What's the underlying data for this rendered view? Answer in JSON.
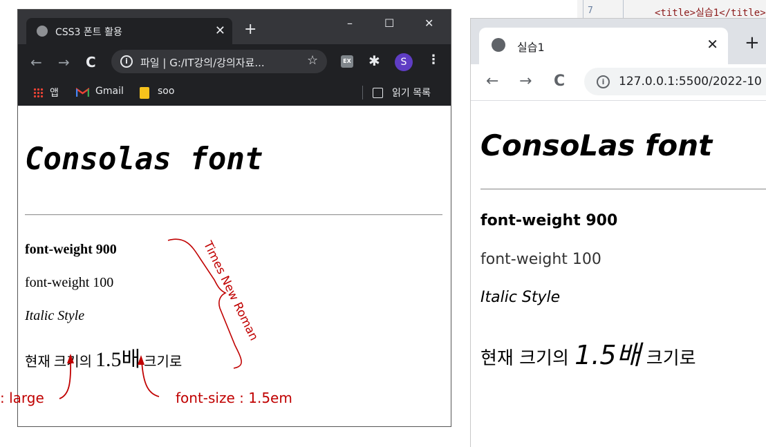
{
  "editor": {
    "line_number": "7",
    "code_line": "<title>실습1</title>"
  },
  "left_browser": {
    "tab_title": "CSS3 폰트 활용",
    "tab_close": "✕",
    "new_tab": "+",
    "window_controls": {
      "minimize": "–",
      "maximize": "☐",
      "close": "✕"
    },
    "nav": {
      "back": "←",
      "forward": "→",
      "reload": "C"
    },
    "address": {
      "info": "i",
      "text": "파일 | G:/IT강의/강의자료...",
      "star": "☆"
    },
    "extensions": {
      "ex_label": "EX",
      "puzzle": "✱",
      "profile_initial": "S",
      "menu": "⋮"
    },
    "bookmarks": [
      {
        "icon": "apps-grid-icon",
        "label": "앱"
      },
      {
        "icon": "gmail-icon",
        "label": "Gmail"
      },
      {
        "icon": "folder-icon",
        "label": "soo"
      }
    ],
    "reading_list": "읽기 목록",
    "page": {
      "heading": "Consolas font",
      "p1": "font-weight 900",
      "p2": "font-weight 100",
      "p3": "Italic Style",
      "p4_a": "현재 크기의 ",
      "p4_b": "1.5배",
      "p4_c": " 크기로"
    }
  },
  "right_browser": {
    "tab_title": "실습1",
    "tab_close": "✕",
    "new_tab": "+",
    "nav": {
      "back": "←",
      "forward": "→",
      "reload": "C"
    },
    "address": {
      "info": "i",
      "text": "127.0.0.1:5500/2022-10"
    },
    "page": {
      "heading": "ConsoLas font",
      "p1": "font-weight 900",
      "p2": "font-weight 100",
      "p3": "Italic Style",
      "p4_a": "현재 크기의 ",
      "p4_b": "1.5배",
      "p4_c": " 크기로"
    }
  },
  "annotations": {
    "brace_label": "Times New Roman",
    "left_arrow_label": ": large",
    "right_arrow_label": "font-size : 1.5em",
    "color": "#c00000"
  }
}
